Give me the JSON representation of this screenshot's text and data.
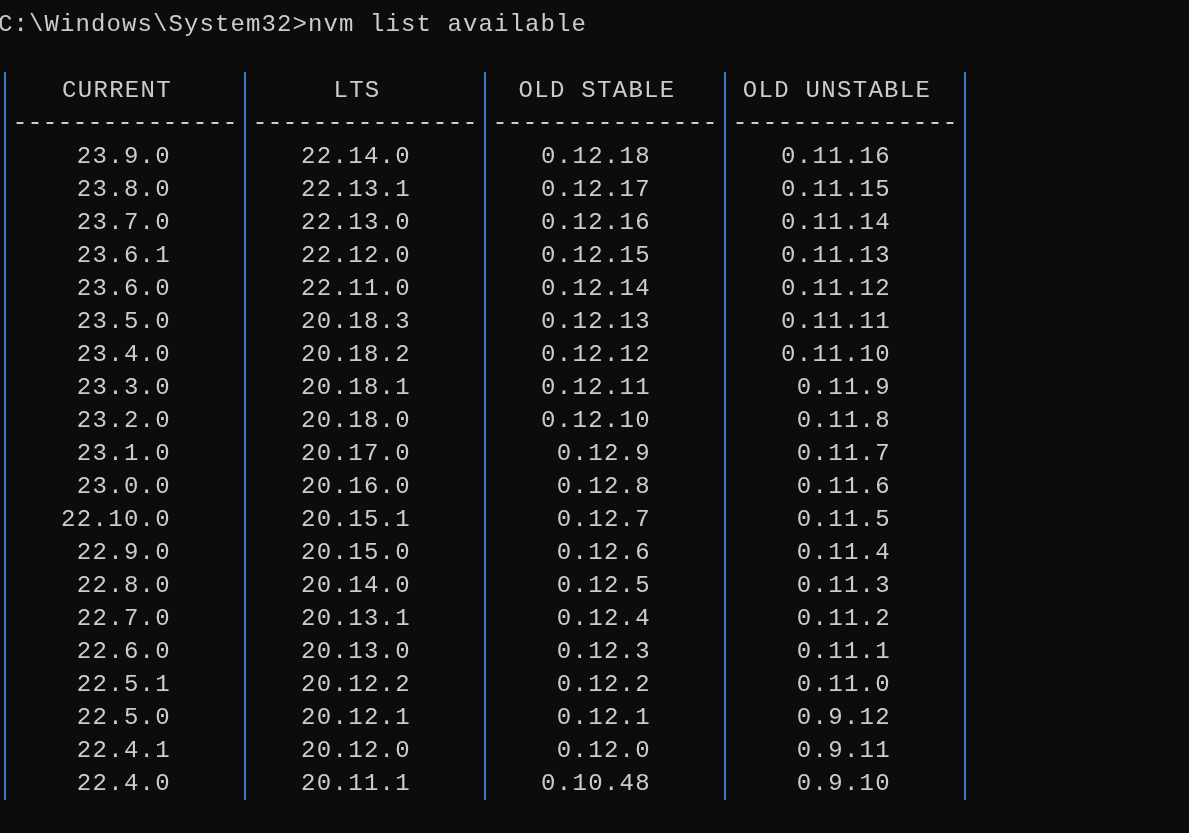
{
  "prompt": "C:\\Windows\\System32>nvm list available",
  "columns": [
    {
      "header": "CURRENT",
      "rule": "---------------",
      "values": [
        "23.9.0",
        "23.8.0",
        "23.7.0",
        "23.6.1",
        "23.6.0",
        "23.5.0",
        "23.4.0",
        "23.3.0",
        "23.2.0",
        "23.1.0",
        "23.0.0",
        "22.10.0",
        "22.9.0",
        "22.8.0",
        "22.7.0",
        "22.6.0",
        "22.5.1",
        "22.5.0",
        "22.4.1",
        "22.4.0"
      ]
    },
    {
      "header": "LTS",
      "rule": "---------------",
      "values": [
        "22.14.0",
        "22.13.1",
        "22.13.0",
        "22.12.0",
        "22.11.0",
        "20.18.3",
        "20.18.2",
        "20.18.1",
        "20.18.0",
        "20.17.0",
        "20.16.0",
        "20.15.1",
        "20.15.0",
        "20.14.0",
        "20.13.1",
        "20.13.0",
        "20.12.2",
        "20.12.1",
        "20.12.0",
        "20.11.1"
      ]
    },
    {
      "header": "OLD STABLE",
      "rule": "---------------",
      "values": [
        "0.12.18",
        "0.12.17",
        "0.12.16",
        "0.12.15",
        "0.12.14",
        "0.12.13",
        "0.12.12",
        "0.12.11",
        "0.12.10",
        "0.12.9",
        "0.12.8",
        "0.12.7",
        "0.12.6",
        "0.12.5",
        "0.12.4",
        "0.12.3",
        "0.12.2",
        "0.12.1",
        "0.12.0",
        "0.10.48"
      ]
    },
    {
      "header": "OLD UNSTABLE",
      "rule": "---------------",
      "values": [
        "0.11.16",
        "0.11.15",
        "0.11.14",
        "0.11.13",
        "0.11.12",
        "0.11.11",
        "0.11.10",
        "0.11.9",
        "0.11.8",
        "0.11.7",
        "0.11.6",
        "0.11.5",
        "0.11.4",
        "0.11.3",
        "0.11.2",
        "0.11.1",
        "0.11.0",
        "0.9.12",
        "0.9.11",
        "0.9.10"
      ]
    }
  ]
}
